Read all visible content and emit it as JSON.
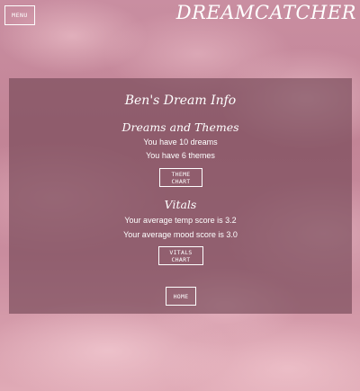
{
  "header": {
    "menu_label": "MENU",
    "brand": "DREAMCATCHER"
  },
  "panel": {
    "title": "Ben's Dream Info",
    "dreams": {
      "heading": "Dreams and Themes",
      "dreams_line": "You have 10 dreams",
      "themes_line": "You have 6 themes",
      "chart_button": "THEME CHART"
    },
    "vitals": {
      "heading": "Vitals",
      "temp_line": "Your average temp score is 3.2",
      "mood_line": "Your average mood score is 3.0",
      "chart_button": "VITALS CHART"
    },
    "home_button": "HOME"
  }
}
